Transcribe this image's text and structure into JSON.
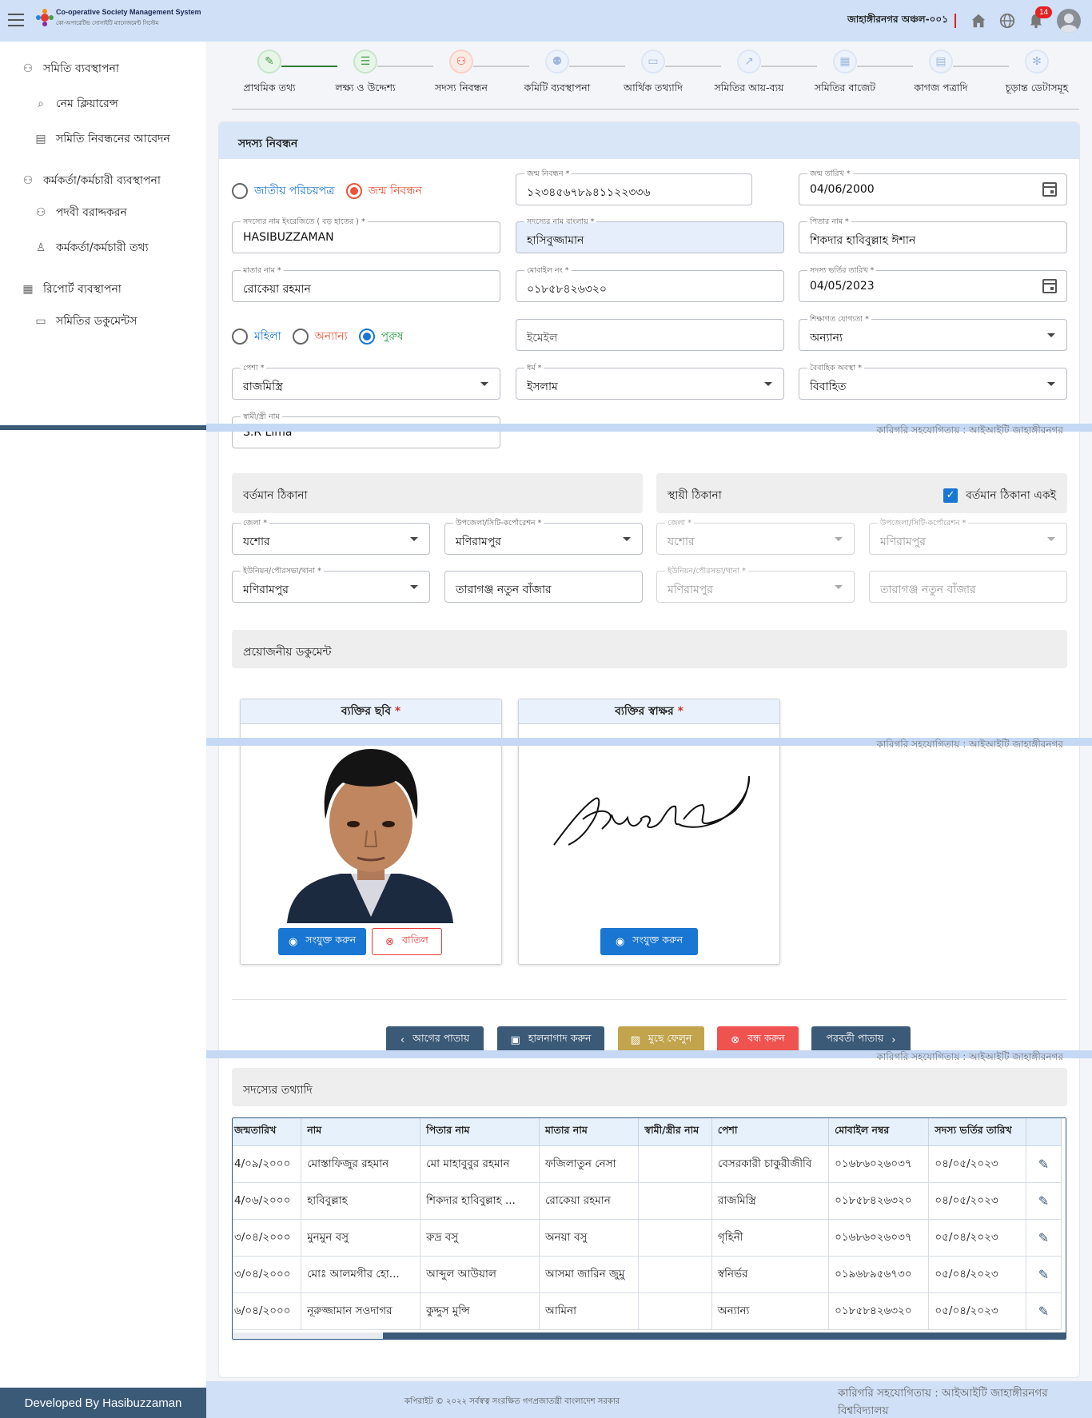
{
  "header": {
    "app_title": "Co-operative Society Management System",
    "app_subtitle": "কো-অপারেটিভ সোসাইটি ম্যানেজমেন্ট সিস্টেম",
    "region": "জাহাঙ্গীরনগর অঞ্চল-০০১",
    "notification_count": "14"
  },
  "sidebar": {
    "items": [
      {
        "label": "সমিতি ব্যবস্থাপনা",
        "icon": "group-icon"
      },
      {
        "label": "নেম ক্লিয়ারেন্স",
        "icon": "search-icon"
      },
      {
        "label": "সমিতি নিবন্ধনের আবেদন",
        "icon": "document-icon"
      },
      {
        "label": "কর্মকর্তা/কর্মচারী ব্যবস্থাপনা",
        "icon": "staff-icon"
      },
      {
        "label": "পদবী বরাদ্দকরন",
        "icon": "staff-icon"
      },
      {
        "label": "কর্মকর্তা/কর্মচারী তথ্য",
        "icon": "person-icon"
      },
      {
        "label": "রিপোর্ট ব্যবস্থাপনা",
        "icon": "report-icon"
      },
      {
        "label": "সমিতির ডকুমেন্টস",
        "icon": "folder-icon"
      }
    ],
    "developer_credit": "Developed By Hasibuzzaman"
  },
  "stepper": {
    "steps": [
      {
        "label": "প্রাথমিক তথ্য",
        "state": "done"
      },
      {
        "label": "লক্ষ্য ও উদ্দেশ্য",
        "state": "done"
      },
      {
        "label": "সদস্য নিবন্ধন",
        "state": "active"
      },
      {
        "label": "কমিটি ব্যবস্থাপনা",
        "state": "pending"
      },
      {
        "label": "আর্থিক তথ্যাদি",
        "state": "pending"
      },
      {
        "label": "সমিতির আয়-ব্যয়",
        "state": "pending"
      },
      {
        "label": "সমিতির বাজেট",
        "state": "pending"
      },
      {
        "label": "কাগজ পত্রাদি",
        "state": "pending"
      },
      {
        "label": "চূড়ান্ত ডেটাসমূহ",
        "state": "pending"
      }
    ]
  },
  "form": {
    "title": "সদস্য নিবন্ধন",
    "id_type": {
      "nid_label": "জাতীয় পরিচয়পত্র",
      "birth_reg_label": "জন্ম নিবন্ধন",
      "selected": "birth_reg"
    },
    "birth_reg": {
      "label": "জন্ম নিবন্ধন *",
      "value": "১২৩৪৫৬৭৮৯৪১১২২৩৩৬"
    },
    "dob": {
      "label": "জন্ম তারিখ *",
      "value": "04/06/2000"
    },
    "name_en": {
      "label": "সদস্যের নাম ইংরেজিতে ( বড় হাতের ) *",
      "value": "HASIBUZZAMAN"
    },
    "name_bn": {
      "label": "সদস্যের নাম বাংলায় *",
      "value": "হাসিবুজ্জামান"
    },
    "father": {
      "label": "পিতার নাম *",
      "value": "শিকদার হাবিবুল্লাহ ঈশান"
    },
    "mother": {
      "label": "মাতার নাম *",
      "value": "রোকেয়া রহমান"
    },
    "mobile": {
      "label": "মোবাইল নং *",
      "value": "০১৮৫৮৪২৬৩২০"
    },
    "admission_date": {
      "label": "সদস্য ভর্তির তারিখ *",
      "value": "04/05/2023"
    },
    "gender": {
      "female": "মহিলা",
      "other": "অন্যান্য",
      "male": "পুরুষ",
      "selected": "male"
    },
    "email": {
      "placeholder": "ইমেইল"
    },
    "education": {
      "label": "শিক্ষাগত যোগ্যতা *",
      "value": "অন্যান্য"
    },
    "profession": {
      "label": "পেশা *",
      "value": "রাজমিস্ত্রি"
    },
    "religion": {
      "label": "ধর্ম *",
      "value": "ইসলাম"
    },
    "marital": {
      "label": "বৈবাহিক অবস্থা *",
      "value": "বিবাহিত"
    },
    "spouse": {
      "label": "স্বামী/স্ত্রী নাম",
      "value": "S.R Lima"
    }
  },
  "address": {
    "present_title": "বর্তমান ঠিকানা",
    "permanent_title": "স্থায়ী ঠিকানা",
    "same_label": "বর্তমান ঠিকানা একই",
    "present": {
      "district": {
        "label": "জেলা *",
        "value": "যশোর"
      },
      "upazila": {
        "label": "উপজেলা/সিটি-কর্পোরেশন *",
        "value": "মণিরামপুর"
      },
      "union": {
        "label": "ইউনিয়ন/পৌরসভা/থানা *",
        "value": "মণিরামপুর"
      },
      "detail": {
        "value": "তারাগঞ্জ নতুন বাঁজার"
      }
    },
    "permanent": {
      "district": {
        "label": "জেলা *",
        "value": "যশোর"
      },
      "upazila": {
        "label": "উপজেলা/সিটি-কর্পোরেশন *",
        "value": "মণিরামপুর"
      },
      "union": {
        "label": "ইউনিয়ন/পৌরসভা/থানা *",
        "value": "মণিরামপুর"
      },
      "detail": {
        "value": "তারাগঞ্জ নতুন বাঁজার"
      }
    }
  },
  "documents": {
    "title": "প্রয়োজনীয় ডকুমেন্ট",
    "photo_label": "ব্যক্তির ছবি",
    "signature_label": "ব্যক্তির স্বাক্ষর",
    "attach_label": "সংযুক্ত করুন",
    "cancel_label": "বাতিল"
  },
  "actions": {
    "prev": "আগের পাতায়",
    "save": "হালনাগাদ করুন",
    "clear": "মুছে ফেলুন",
    "close": "বন্ধ করুন",
    "next": "পরবর্তী পাতায়"
  },
  "members": {
    "title": "সদস্যের তথ্যাদি",
    "columns": [
      "জন্মতারিখ",
      "নাম",
      "পিতার নাম",
      "মাতার নাম",
      "স্বামী/স্ত্রীর নাম",
      "পেশা",
      "মোবাইল নম্বর",
      "সদস্য ভর্তির তারিখ"
    ],
    "rows": [
      [
        "4/০৯/২০০০",
        "মোস্তাফিজুর রহমান",
        "মো মাহাবুবুর রহমান",
        "ফজিলাতুন নেসা",
        "",
        "বেসরকারী চাকুরীজীবি",
        "০১৬৮৬০২৬০৩৭",
        "০৪/০৫/২০২৩"
      ],
      [
        "4/০৬/২০০০",
        "হাবিবুল্লাহ",
        "শিকদার হাবিবুল্লাহ ...",
        "রোকেয়া রহমান",
        "",
        "রাজমিস্ত্রি",
        "০১৮৫৮৪২৬৩২০",
        "০৪/০৫/২০২৩"
      ],
      [
        "৩/০৪/২০০০",
        "মুনমুন বসু",
        "রুদ্র বসু",
        "অনয়া বসু",
        "",
        "গৃহিনী",
        "০১৬৮৬০২৬০৩৭",
        "০৫/০৪/২০২৩"
      ],
      [
        "৩/০৪/২০০০",
        "মোঃ আলমগীর হো...",
        "আব্দুল আউয়াল",
        "আসমা জারিন জুমু",
        "",
        "স্বনির্ভর",
        "০১৯৬৮৯৫৬৭৩০",
        "০৫/০৪/২০২৩"
      ],
      [
        "৬/০৪/২০০০",
        "নূরুজ্জামান সওদাগর",
        "কুদ্দুস মুন্সি",
        "আমিনা",
        "",
        "অন্যান্য",
        "০১৮৫৮৪২৬৩২০",
        "০৫/০৪/২০২৩"
      ]
    ]
  },
  "bands": {
    "tech_text": "কারিগরি সহযোগিতায় : আইআইটি জাহাঙ্গীরনগর"
  },
  "footer": {
    "copyright": "কপিরাইট © ২০২২ সর্বস্বত্ব সংরক্ষিত গণপ্রজাতন্ত্রী বাংলাদেশ সরকার",
    "tech_support": "কারিগরি সহযোগিতায় : আইআইটি জাহাঙ্গীরনগর বিশ্ববিদ্যালয়"
  },
  "colors": {
    "accent": "#1976d2",
    "active_step": "#e8553b",
    "done_step": "#43a047"
  }
}
